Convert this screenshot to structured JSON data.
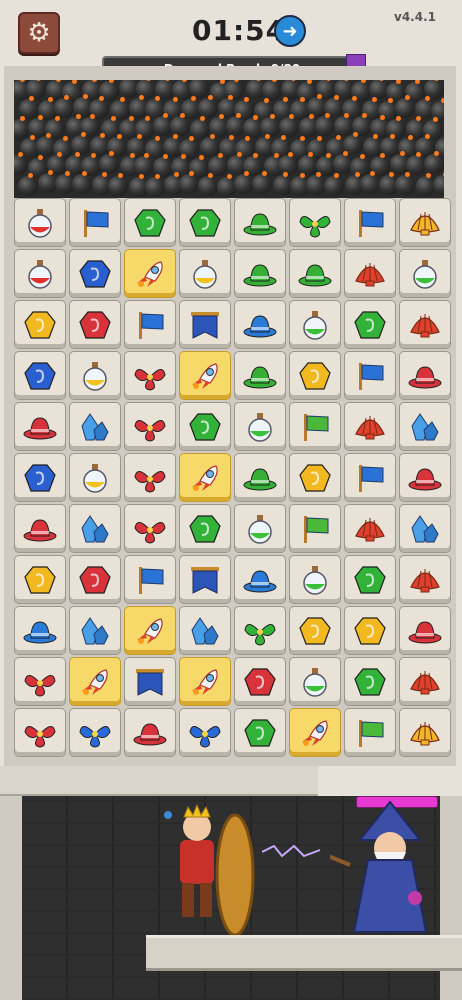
{
  "header": {
    "settings_icon": "gear-icon",
    "timer": "01:54",
    "timer_button_icon": "arrow-right-icon",
    "version": "v4.4.1"
  },
  "banner": {
    "label": "Dropped Bomb",
    "progress": "0/80",
    "badge_icon": "bomb-badge-icon"
  },
  "colors": {
    "flag": "#2a72d6",
    "hat_green": "#35b035",
    "hat_red": "#d8323a",
    "hat_blue": "#2a7ad8",
    "gem_green": "#33b23a",
    "gem_red": "#d8323a",
    "gem_blue": "#2a5fd0",
    "gem_yellow": "#f2b81f",
    "leaf_green": "#33b23a",
    "leaf_red": "#d8323a",
    "leaf_blue": "#2a6ad8",
    "shell_red": "#e0402e",
    "shell_gold": "#f1b72a",
    "potion_red": "#e03030",
    "potion_yellow": "#f2c01f",
    "potion_green": "#3cbf3a",
    "crystal_blue": "#4aa0e6",
    "banner_blue": "#2b55b8",
    "flag_green": "#4ab838",
    "rocket": "#ffffff"
  },
  "board": [
    [
      "potion-red",
      "flag-blue",
      "gem-green",
      "gem-green",
      "hat-green",
      "leaf-green",
      "flag-blue",
      "shell-gold"
    ],
    [
      "potion-red",
      "gem-blue",
      "rocket",
      "potion-yellow",
      "hat-green",
      "hat-green",
      "shell-red",
      "potion-green"
    ],
    [
      "gem-yellow",
      "gem-red",
      "flag-blue",
      "banner-blue",
      "hat-blue",
      "potion-green",
      "gem-green",
      "shell-red"
    ],
    [
      "gem-blue",
      "potion-yellow",
      "leaf-red",
      "rocket",
      "hat-green",
      "gem-yellow",
      "flag-blue",
      "hat-red"
    ],
    [
      "hat-red",
      "crystal-blue",
      "leaf-red",
      "gem-green",
      "potion-green",
      "flag-green",
      "shell-red",
      "crystal-blue"
    ],
    [
      "gem-blue",
      "potion-yellow",
      "leaf-red",
      "rocket",
      "hat-green",
      "gem-yellow",
      "flag-blue",
      "hat-red"
    ],
    [
      "hat-red",
      "crystal-blue",
      "leaf-red",
      "gem-green",
      "potion-green",
      "flag-green",
      "shell-red",
      "crystal-blue"
    ],
    [
      "gem-yellow",
      "gem-red",
      "flag-blue",
      "banner-blue",
      "hat-blue",
      "potion-green",
      "gem-green",
      "shell-red"
    ],
    [
      "hat-blue",
      "crystal-blue",
      "rocket",
      "crystal-blue",
      "leaf-green",
      "gem-yellow",
      "gem-yellow",
      "hat-red"
    ],
    [
      "leaf-red",
      "rocket",
      "banner-blue",
      "rocket",
      "gem-red",
      "potion-green",
      "gem-green",
      "shell-red"
    ],
    [
      "leaf-red",
      "leaf-blue",
      "hat-red",
      "leaf-blue",
      "gem-green",
      "rocket",
      "flag-green",
      "shell-gold"
    ]
  ],
  "characters": {
    "player": "knight-king",
    "enemy": "wizard",
    "enemy_health": 1.0
  }
}
